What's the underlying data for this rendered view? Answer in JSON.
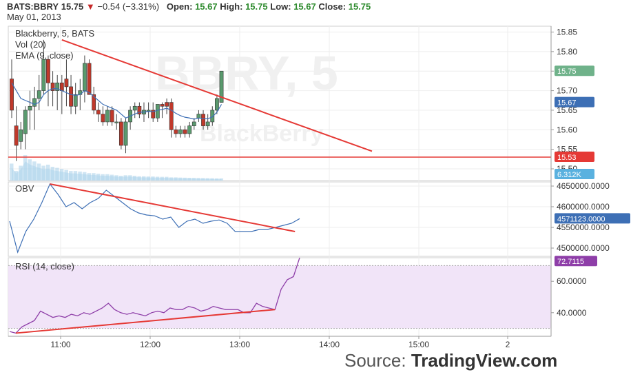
{
  "header": {
    "symbol": "BATS:BBRY",
    "last": "15.75",
    "change_arrow": "▼",
    "change": "−0.54 (−3.31%)",
    "open_label": "Open:",
    "open": "15.67",
    "high_label": "High:",
    "high": "15.75",
    "low_label": "Low:",
    "low": "15.67",
    "close_label": "Close:",
    "close": "15.75",
    "date": "May 01, 2013"
  },
  "watermark": {
    "symbol": "BBRY, 5",
    "name": "BlackBerry"
  },
  "source": {
    "prefix": "Source:",
    "brand": "TradingView.com"
  },
  "colors": {
    "up": "#5a9a6e",
    "down": "#c0392b",
    "trend": "#e53935",
    "ema": "#3d6fb5",
    "obv": "#3d6fb5",
    "rsi": "#8e3ea8",
    "rsi_band": "#f1e4f8",
    "volume": "#a7d0ea"
  },
  "chart_data": [
    {
      "type": "candlestick",
      "title": "Blackberry, 5, BATS",
      "legend": [
        "Vol (20)",
        "EMA (9, close)"
      ],
      "x_ticks": [
        "11:00",
        "12:00",
        "13:00",
        "14:00",
        "15:00",
        "2"
      ],
      "y_ticks": [
        "15.85",
        "15.80",
        "15.75",
        "15.70",
        "15.65",
        "15.60",
        "15.55",
        "15.50"
      ],
      "ylim": [
        15.47,
        15.865
      ],
      "candles": [
        {
          "o": 15.73,
          "h": 15.78,
          "l": 15.63,
          "c": 15.65
        },
        {
          "o": 15.61,
          "h": 15.66,
          "l": 15.52,
          "c": 15.56
        },
        {
          "o": 15.57,
          "h": 15.62,
          "l": 15.55,
          "c": 15.6
        },
        {
          "o": 15.59,
          "h": 15.66,
          "l": 15.55,
          "c": 15.65
        },
        {
          "o": 15.65,
          "h": 15.7,
          "l": 15.6,
          "c": 15.66
        },
        {
          "o": 15.66,
          "h": 15.71,
          "l": 15.6,
          "c": 15.68
        },
        {
          "o": 15.68,
          "h": 15.74,
          "l": 15.65,
          "c": 15.7
        },
        {
          "o": 15.7,
          "h": 15.83,
          "l": 15.69,
          "c": 15.78
        },
        {
          "o": 15.78,
          "h": 15.79,
          "l": 15.66,
          "c": 15.72
        },
        {
          "o": 15.72,
          "h": 15.75,
          "l": 15.66,
          "c": 15.7
        },
        {
          "o": 15.7,
          "h": 15.74,
          "l": 15.65,
          "c": 15.72
        },
        {
          "o": 15.72,
          "h": 15.74,
          "l": 15.64,
          "c": 15.7
        },
        {
          "o": 15.73,
          "h": 15.78,
          "l": 15.66,
          "c": 15.71
        },
        {
          "o": 15.71,
          "h": 15.74,
          "l": 15.64,
          "c": 15.66
        },
        {
          "o": 15.66,
          "h": 15.72,
          "l": 15.64,
          "c": 15.69
        },
        {
          "o": 15.69,
          "h": 15.73,
          "l": 15.65,
          "c": 15.7
        },
        {
          "o": 15.7,
          "h": 15.79,
          "l": 15.67,
          "c": 15.77
        },
        {
          "o": 15.77,
          "h": 15.78,
          "l": 15.69,
          "c": 15.69
        },
        {
          "o": 15.69,
          "h": 15.71,
          "l": 15.64,
          "c": 15.65
        },
        {
          "o": 15.65,
          "h": 15.67,
          "l": 15.62,
          "c": 15.64
        },
        {
          "o": 15.64,
          "h": 15.66,
          "l": 15.61,
          "c": 15.62
        },
        {
          "o": 15.62,
          "h": 15.66,
          "l": 15.61,
          "c": 15.65
        },
        {
          "o": 15.65,
          "h": 15.66,
          "l": 15.61,
          "c": 15.62
        },
        {
          "o": 15.62,
          "h": 15.64,
          "l": 15.6,
          "c": 15.62
        },
        {
          "o": 15.62,
          "h": 15.63,
          "l": 15.55,
          "c": 15.56
        },
        {
          "o": 15.56,
          "h": 15.63,
          "l": 15.54,
          "c": 15.62
        },
        {
          "o": 15.62,
          "h": 15.66,
          "l": 15.6,
          "c": 15.65
        },
        {
          "o": 15.65,
          "h": 15.67,
          "l": 15.63,
          "c": 15.66
        },
        {
          "o": 15.66,
          "h": 15.67,
          "l": 15.63,
          "c": 15.64
        },
        {
          "o": 15.64,
          "h": 15.67,
          "l": 15.62,
          "c": 15.65
        },
        {
          "o": 15.65,
          "h": 15.67,
          "l": 15.63,
          "c": 15.65
        },
        {
          "o": 15.65,
          "h": 15.67,
          "l": 15.62,
          "c": 15.63
        },
        {
          "o": 15.63,
          "h": 15.66,
          "l": 15.62,
          "c": 15.665
        },
        {
          "o": 15.665,
          "h": 15.67,
          "l": 15.63,
          "c": 15.66
        },
        {
          "o": 15.67,
          "h": 15.68,
          "l": 15.64,
          "c": 15.66
        },
        {
          "o": 15.67,
          "h": 15.68,
          "l": 15.58,
          "c": 15.6
        },
        {
          "o": 15.6,
          "h": 15.61,
          "l": 15.58,
          "c": 15.59
        },
        {
          "o": 15.59,
          "h": 15.61,
          "l": 15.58,
          "c": 15.6
        },
        {
          "o": 15.6,
          "h": 15.61,
          "l": 15.58,
          "c": 15.59
        },
        {
          "o": 15.59,
          "h": 15.62,
          "l": 15.58,
          "c": 15.61
        },
        {
          "o": 15.61,
          "h": 15.63,
          "l": 15.6,
          "c": 15.62
        },
        {
          "o": 15.63,
          "h": 15.65,
          "l": 15.62,
          "c": 15.64
        },
        {
          "o": 15.64,
          "h": 15.65,
          "l": 15.6,
          "c": 15.61
        },
        {
          "o": 15.61,
          "h": 15.64,
          "l": 15.6,
          "c": 15.62
        },
        {
          "o": 15.62,
          "h": 15.66,
          "l": 15.61,
          "c": 15.65
        },
        {
          "o": 15.65,
          "h": 15.69,
          "l": 15.64,
          "c": 15.68
        },
        {
          "o": 15.67,
          "h": 15.75,
          "l": 15.67,
          "c": 15.75
        }
      ],
      "ema": [
        15.72,
        15.7,
        15.68,
        15.675,
        15.67,
        15.665,
        15.67,
        15.69,
        15.7,
        15.705,
        15.705,
        15.7,
        15.695,
        15.69,
        15.688,
        15.69,
        15.7,
        15.695,
        15.685,
        15.675,
        15.665,
        15.66,
        15.655,
        15.65,
        15.64,
        15.63,
        15.635,
        15.64,
        15.645,
        15.645,
        15.647,
        15.646,
        15.65,
        15.652,
        15.655,
        15.65,
        15.642,
        15.636,
        15.632,
        15.63,
        15.627,
        15.63,
        15.628,
        15.628,
        15.633,
        15.645,
        15.665
      ],
      "volume": [
        1.6,
        0.9,
        1.4,
        2.4,
        2.0,
        1.8,
        1.6,
        1.4,
        1.5,
        1.3,
        1.2,
        1.1,
        1.0,
        0.9,
        0.9,
        0.85,
        0.8,
        0.7,
        0.7,
        0.65,
        0.6,
        0.6,
        0.55,
        0.5,
        0.45,
        0.5,
        0.5,
        0.45,
        0.4,
        0.4,
        0.38,
        0.38,
        0.36,
        0.35,
        0.35,
        0.3,
        0.3,
        0.28,
        0.27,
        0.26,
        0.25,
        0.24,
        0.23,
        0.22,
        0.21,
        0.2,
        0.2
      ],
      "price_labels": {
        "last": "15.75",
        "ema": "15.67",
        "level": "15.53",
        "volume": "6.312K"
      },
      "trendlines": [
        {
          "x1": 11,
          "y1": 15.83,
          "x2": 79,
          "y2": 15.545
        },
        {
          "x1": 0,
          "y1": 15.53,
          "x2": 120,
          "y2": 15.53
        }
      ]
    },
    {
      "type": "line",
      "title": "OBV",
      "y_ticks": [
        "4650000.0000",
        "4600000.0000",
        "4550000.0000",
        "4500000.0000"
      ],
      "ylim": [
        4480000,
        4660000
      ],
      "last_label": "4571123.0000",
      "values": [
        4565000,
        4490000,
        4540000,
        4570000,
        4610000,
        4655000,
        4630000,
        4600000,
        4610000,
        4595000,
        4610000,
        4620000,
        4640000,
        4625000,
        4610000,
        4595000,
        4585000,
        4580000,
        4578000,
        4570000,
        4575000,
        4550000,
        4565000,
        4570000,
        4560000,
        4565000,
        4568000,
        4560000,
        4540000,
        4540000,
        4540000,
        4545000,
        4545000,
        4550000,
        4555000,
        4560000,
        4571123
      ],
      "trendline": {
        "x1": 5,
        "y1": 4655000,
        "x2": 32,
        "y2": 4540000
      }
    },
    {
      "type": "line",
      "title": "RSI (14, close)",
      "y_ticks": [
        "60.0000",
        "40.0000"
      ],
      "ylim": [
        25,
        75
      ],
      "band": [
        30,
        70
      ],
      "last_label": "72.7115",
      "values": [
        28,
        27,
        31,
        33,
        35,
        41,
        39,
        37,
        38,
        37,
        39,
        38,
        40,
        39,
        41,
        43,
        46,
        42,
        40,
        39,
        40,
        39,
        38,
        40,
        41,
        40,
        43,
        42,
        42,
        44,
        43,
        41,
        42,
        44,
        43,
        42,
        42,
        42,
        40,
        40,
        46,
        44,
        43,
        42,
        55,
        61,
        63,
        75
      ],
      "trendline": {
        "x1": 1,
        "y1": 27,
        "x2": 43,
        "y2": 42
      }
    }
  ]
}
